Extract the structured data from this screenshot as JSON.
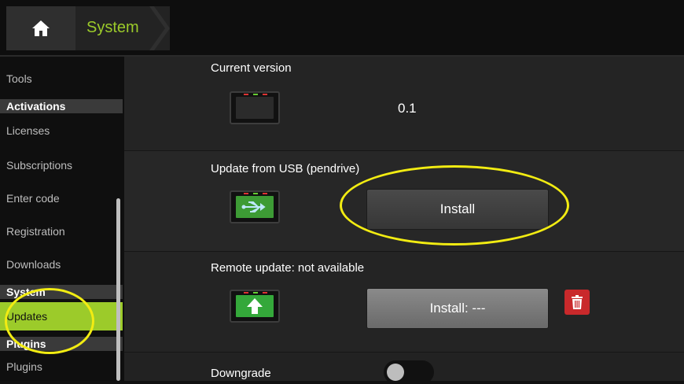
{
  "header": {
    "home_icon": "home-icon",
    "breadcrumb": "System"
  },
  "sidebar": {
    "items": [
      {
        "label": "Tools",
        "type": "item"
      },
      {
        "label": "Activations",
        "type": "header"
      },
      {
        "label": "Licenses",
        "type": "item"
      },
      {
        "label": "Subscriptions",
        "type": "item"
      },
      {
        "label": "Enter code",
        "type": "item"
      },
      {
        "label": "Registration",
        "type": "item"
      },
      {
        "label": "Downloads",
        "type": "item"
      },
      {
        "label": "System",
        "type": "header"
      },
      {
        "label": "Updates",
        "type": "item",
        "active": true
      },
      {
        "label": "Plugins",
        "type": "header"
      },
      {
        "label": "Plugins",
        "type": "item"
      }
    ]
  },
  "main": {
    "current_version": {
      "label": "Current version",
      "value": "0.1",
      "icon": "device-icon"
    },
    "usb_update": {
      "label": "Update from USB (pendrive)",
      "button": "Install",
      "icon": "usb-device-icon"
    },
    "remote_update": {
      "label": "Remote update: not available",
      "button": "Install: ---",
      "icon": "upload-device-icon",
      "delete_icon": "trash-icon"
    },
    "downgrade": {
      "label": "Downgrade",
      "enabled": false
    }
  },
  "colors": {
    "accent": "#9ccb2a",
    "annotation": "#f2ec12",
    "danger": "#c9292b"
  }
}
